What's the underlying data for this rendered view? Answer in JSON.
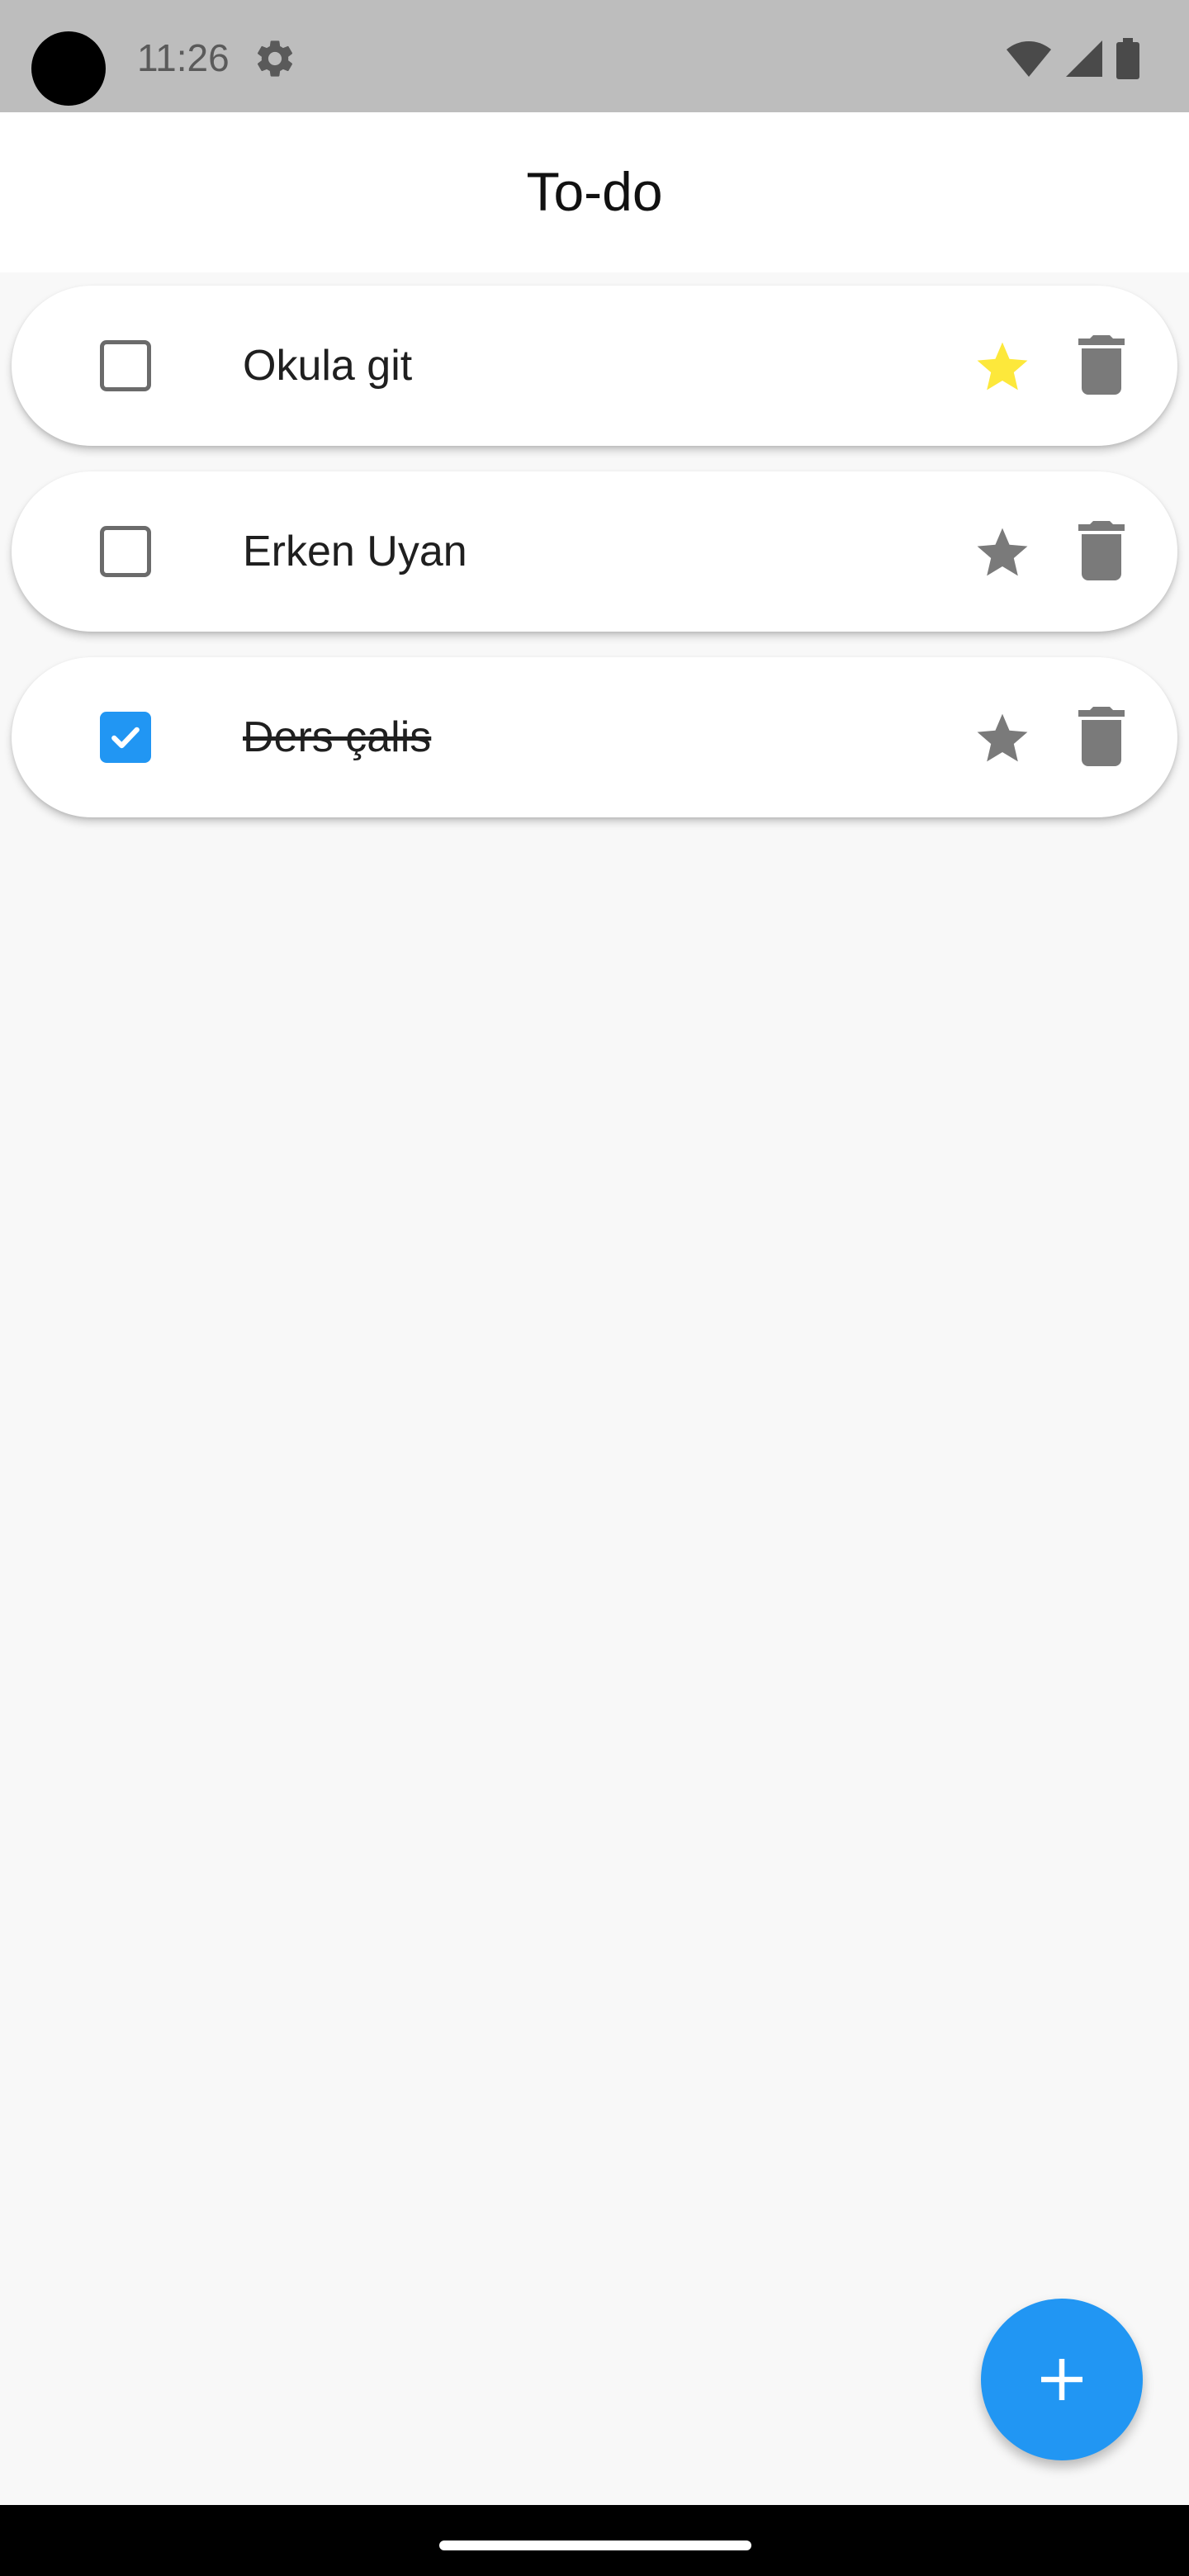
{
  "status_bar": {
    "time": "11:26"
  },
  "app_bar": {
    "title": "To-do"
  },
  "todos": [
    {
      "text": "Okula git",
      "checked": false,
      "starred": true
    },
    {
      "text": "Erken Uyan",
      "checked": false,
      "starred": false
    },
    {
      "text": "Ders çalis",
      "checked": true,
      "starred": false
    }
  ],
  "colors": {
    "accent": "#2196f3",
    "star_active": "#fde83b",
    "star_inactive": "#7a7a7a",
    "icon_gray": "#7a7a7a"
  },
  "icons": {
    "status": [
      "settings-gear-icon",
      "wifi-icon",
      "cellular-signal-icon",
      "battery-icon"
    ],
    "row": [
      "checkbox-icon",
      "star-icon",
      "trash-icon"
    ],
    "fab": "plus-icon"
  }
}
